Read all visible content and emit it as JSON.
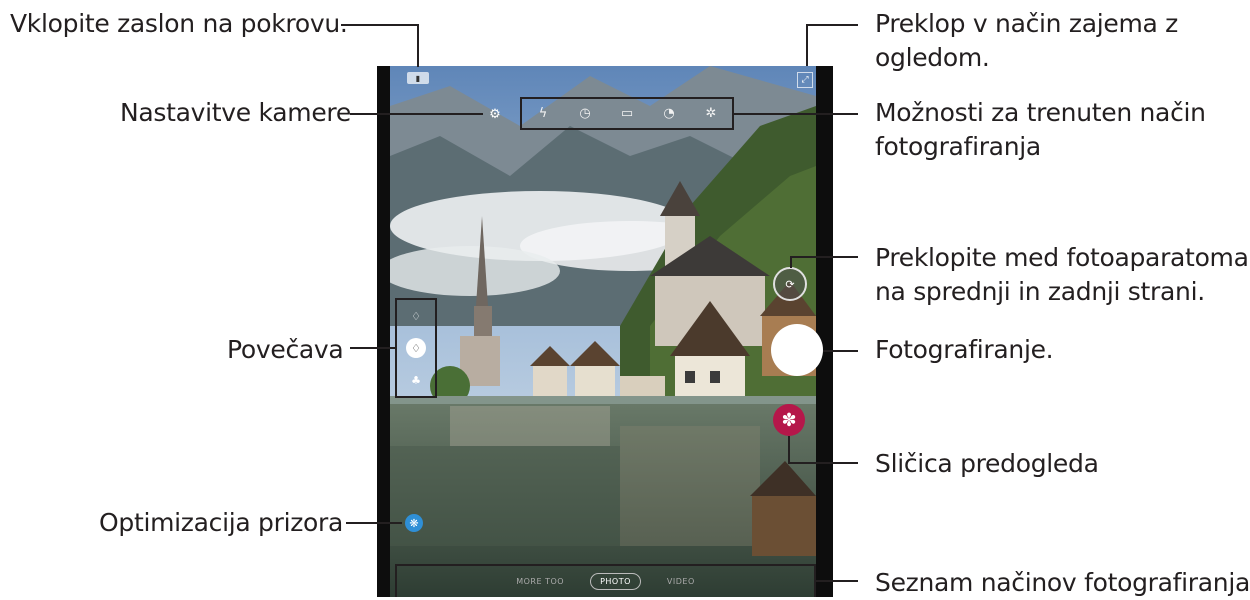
{
  "callouts": {
    "cover_screen": "Vklopite zaslon na pokrovu.",
    "camera_settings": "Nastavitve kamere",
    "zoom": "Povečava",
    "scene_optimizer": "Optimizacija prizora",
    "preview_mode_line1": "Preklop v način zajema z",
    "preview_mode_line2": "ogledom.",
    "mode_options_line1": "Možnosti za trenuten način",
    "mode_options_line2": "fotografiranja",
    "switch_cameras_line1": "Preklopite med fotoaparatoma",
    "switch_cameras_line2": "na sprednji in zadnji strani.",
    "take_picture": "Fotografiranje.",
    "preview_thumbnail": "Sličica predogleda",
    "shooting_modes_list": "Seznam načinov fotografiranja"
  },
  "camera": {
    "mode_list": [
      "MORE TOO",
      "PHOTO",
      "VIDEO"
    ],
    "active_mode": "PHOTO",
    "options_icons": [
      "flash-off-icon",
      "timer-icon",
      "ratio-icon",
      "motion-photo-icon",
      "filter-icon"
    ],
    "zoom_levels": [
      "ultra-wide",
      "wide",
      "tele"
    ],
    "active_zoom": "wide"
  },
  "colors": {
    "callout_text": "#231f20",
    "thumbnail_accent": "#b5174a",
    "scene_optimizer_accent": "#2f8fd6",
    "shutter": "#ffffff"
  }
}
